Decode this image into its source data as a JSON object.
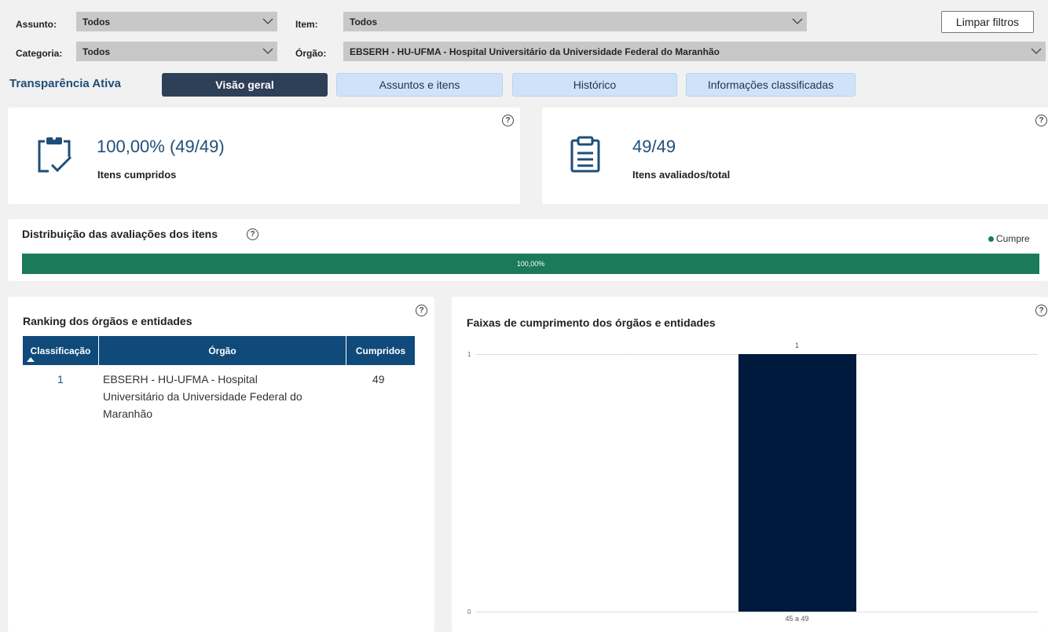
{
  "filters": {
    "assunto_label": "Assunto:",
    "assunto_value": "Todos",
    "item_label": "Item:",
    "item_value": "Todos",
    "categoria_label": "Categoria:",
    "categoria_value": "Todos",
    "orgao_label": "Órgão:",
    "orgao_value": "EBSERH - HU-UFMA - Hospital Universitário da Universidade Federal do Maranhão",
    "clear_button": "Limpar filtros"
  },
  "section": {
    "title": "Transparência Ativa"
  },
  "tabs": [
    {
      "label": "Visão geral",
      "active": true
    },
    {
      "label": "Assuntos e itens",
      "active": false
    },
    {
      "label": "Histórico",
      "active": false
    },
    {
      "label": "Informações classificadas",
      "active": false
    }
  ],
  "kpis": {
    "cumpridos": {
      "value": "100,00% (49/49)",
      "label": "Itens cumpridos",
      "icon": "clipboard-check-icon"
    },
    "avaliados": {
      "value": "49/49",
      "label": "Itens avaliados/total",
      "icon": "clipboard-list-icon"
    }
  },
  "distribution": {
    "title": "Distribuição das avaliações dos itens",
    "legend": "Cumpre",
    "bar_label": "100,00%",
    "value_pct": 100,
    "color": "#1a7a5a"
  },
  "ranking": {
    "title": "Ranking dos órgãos e entidades",
    "columns": [
      "Classificação",
      "Órgão",
      "Cumpridos"
    ],
    "rows": [
      {
        "rank": "1",
        "orgao_lines": [
          "EBSERH - HU-UFMA - Hospital",
          "Universitário da Universidade Federal do",
          "Maranhão"
        ],
        "cumpridos": "49"
      }
    ],
    "header_color": "#0f4a7a"
  },
  "faixas": {
    "title": "Faixas de cumprimento dos órgãos e entidades"
  },
  "chart_data": {
    "type": "bar",
    "title": "Faixas de cumprimento dos órgãos e entidades",
    "categories": [
      "45 a 49"
    ],
    "values": [
      1
    ],
    "data_labels": [
      "1"
    ],
    "yticks": [
      "1",
      "0"
    ],
    "ylim": [
      0,
      1
    ],
    "xlabel": "",
    "ylabel": "",
    "grid": true,
    "bar_color": "#001a3d"
  }
}
